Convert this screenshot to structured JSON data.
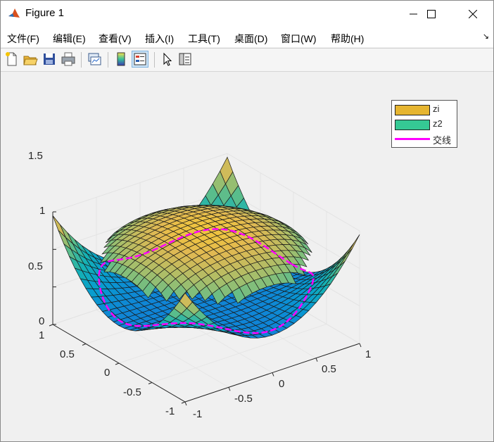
{
  "window": {
    "title": "Figure 1"
  },
  "menu": [
    {
      "label": "文件(F)"
    },
    {
      "label": "编辑(E)"
    },
    {
      "label": "查看(V)"
    },
    {
      "label": "插入(I)"
    },
    {
      "label": "工具(T)"
    },
    {
      "label": "桌面(D)"
    },
    {
      "label": "窗口(W)"
    },
    {
      "label": "帮助(H)"
    }
  ],
  "toolbar": [
    {
      "icon": "new-figure-icon"
    },
    {
      "icon": "open-file-icon"
    },
    {
      "icon": "save-icon"
    },
    {
      "icon": "print-icon"
    },
    {
      "icon": "link-plot-icon"
    },
    {
      "icon": "insert-colorbar-icon"
    },
    {
      "icon": "insert-legend-icon",
      "active": true
    },
    {
      "icon": "pointer-icon"
    },
    {
      "icon": "property-inspector-icon"
    }
  ],
  "legend": {
    "items": [
      {
        "label": "zi",
        "color": "#e6b530",
        "kind": "patch"
      },
      {
        "label": "z2",
        "color": "#35c994",
        "kind": "patch"
      },
      {
        "label": "交线",
        "color": "#ff00ff",
        "kind": "line"
      }
    ]
  },
  "axes": {
    "z_ticks": [
      "0",
      "0.5",
      "1",
      "1.5"
    ],
    "y_ticks": [
      "1",
      "0.5",
      "0",
      "-0.5",
      "-1"
    ],
    "x_ticks": [
      "-1",
      "-0.5",
      "0",
      "0.5",
      "1"
    ]
  },
  "chart_data": {
    "type": "surface",
    "series": [
      {
        "name": "zi",
        "kind": "surface",
        "formula": "hemisphere"
      },
      {
        "name": "z2",
        "kind": "surface",
        "formula": "saddle"
      },
      {
        "name": "交线",
        "kind": "line"
      }
    ],
    "xlim": [
      -1,
      1
    ],
    "ylim": [
      -1,
      1
    ],
    "zlim": [
      0,
      1.5
    ],
    "grid": true,
    "legend_position": "top-right"
  }
}
